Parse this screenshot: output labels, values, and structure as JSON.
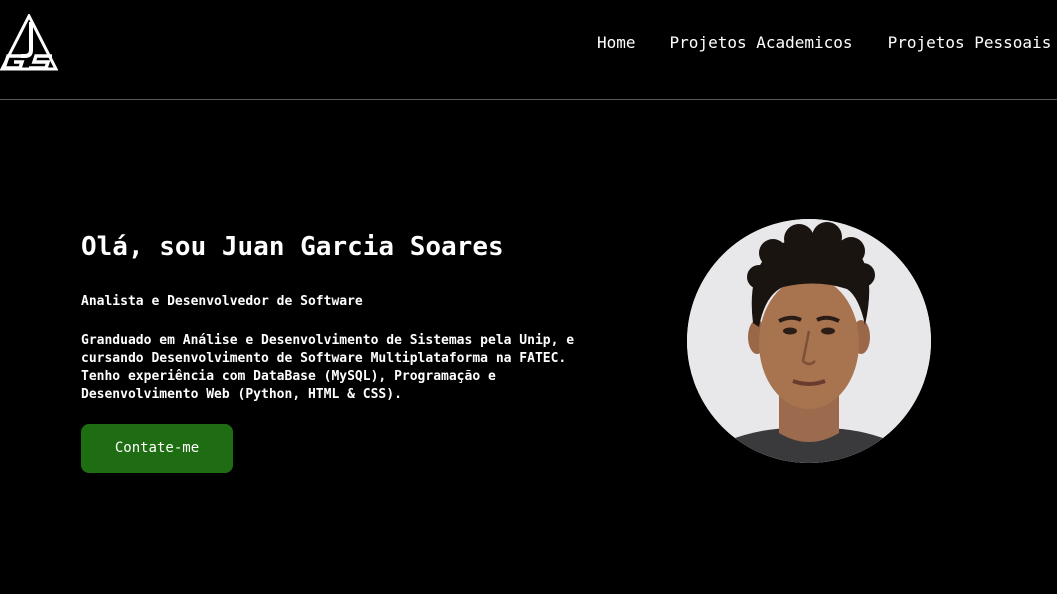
{
  "header": {
    "logo_text": "JGS",
    "nav": {
      "home": "Home",
      "academic": "Projetos Academicos",
      "personal": "Projetos Pessoais"
    }
  },
  "hero": {
    "title": "Olá, sou Juan Garcia Soares",
    "subtitle": "Analista e Desenvolvedor de Software",
    "description": "Granduado em Análise e Desenvolvimento de Sistemas pela Unip, e cursando Desenvolvimento de Software Multiplataforma na FATEC. Tenho experiência com DataBase (MySQL), Programação e Desenvolvimento Web (Python, HTML & CSS).",
    "contact_button": "Contate-me"
  },
  "colors": {
    "background": "#000000",
    "text": "#ffffff",
    "button": "#1f6d13",
    "divider": "#5a5a5a"
  }
}
